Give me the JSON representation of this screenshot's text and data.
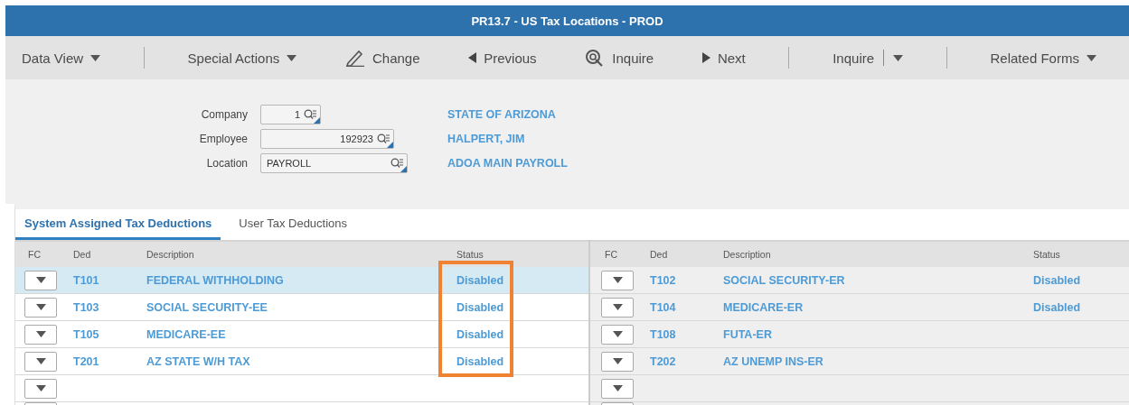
{
  "window": {
    "title": "PR13.7 - US Tax Locations - PROD"
  },
  "toolbar": [
    {
      "kind": "menu",
      "label": "Data View"
    },
    {
      "kind": "divider"
    },
    {
      "kind": "menu",
      "label": "Special Actions"
    },
    {
      "kind": "pencil",
      "label": "Change"
    },
    {
      "kind": "back",
      "label": "Previous"
    },
    {
      "kind": "lookup",
      "label": "Inquire"
    },
    {
      "kind": "forward",
      "label": "Next"
    },
    {
      "kind": "divider"
    },
    {
      "kind": "split",
      "label": "Inquire"
    },
    {
      "kind": "divider"
    },
    {
      "kind": "menu",
      "label": "Related Forms"
    }
  ],
  "form": [
    {
      "label": "Company",
      "value": "1",
      "kind": "numeric",
      "description": "STATE OF ARIZONA"
    },
    {
      "label": "Employee",
      "value": "192923",
      "kind": "numeric",
      "description": "HALPERT, JIM"
    },
    {
      "label": "Location",
      "value": "PAYROLL",
      "kind": "code",
      "description": "ADOA MAIN PAYROLL"
    }
  ],
  "tabs": [
    {
      "label": "System Assigned Tax Deductions",
      "selected": true
    },
    {
      "label": "User Tax Deductions",
      "selected": false
    }
  ],
  "grids": [
    {
      "columns": [
        "FC",
        "Ded",
        "Description",
        "Status"
      ],
      "rows": [
        {
          "kind": "entry",
          "selected": true,
          "ded": "T101",
          "description": "FEDERAL WITHHOLDING",
          "status": "Disabled"
        },
        {
          "kind": "entry",
          "selected": false,
          "ded": "T103",
          "description": "SOCIAL SECURITY-EE",
          "status": "Disabled"
        },
        {
          "kind": "entry",
          "selected": false,
          "ded": "T105",
          "description": "MEDICARE-EE",
          "status": "Disabled"
        },
        {
          "kind": "entry",
          "selected": false,
          "ded": "T201",
          "description": "AZ STATE W/H TAX",
          "status": "Disabled"
        },
        {
          "kind": "blank",
          "selected": false
        },
        {
          "kind": "blank",
          "selected": false
        }
      ]
    },
    {
      "columns": [
        "FC",
        "Ded",
        "Description",
        "Status"
      ],
      "rows": [
        {
          "kind": "entry",
          "selected": false,
          "ded": "T102",
          "description": "SOCIAL SECURITY-ER",
          "status": "Disabled"
        },
        {
          "kind": "entry",
          "selected": false,
          "ded": "T104",
          "description": "MEDICARE-ER",
          "status": "Disabled"
        },
        {
          "kind": "entry",
          "selected": false,
          "ded": "T108",
          "description": "FUTA-ER"
        },
        {
          "kind": "entry",
          "selected": false,
          "ded": "T202",
          "description": "AZ UNEMP INS-ER"
        },
        {
          "kind": "blank",
          "selected": false
        },
        {
          "kind": "blank",
          "selected": false
        }
      ]
    }
  ]
}
